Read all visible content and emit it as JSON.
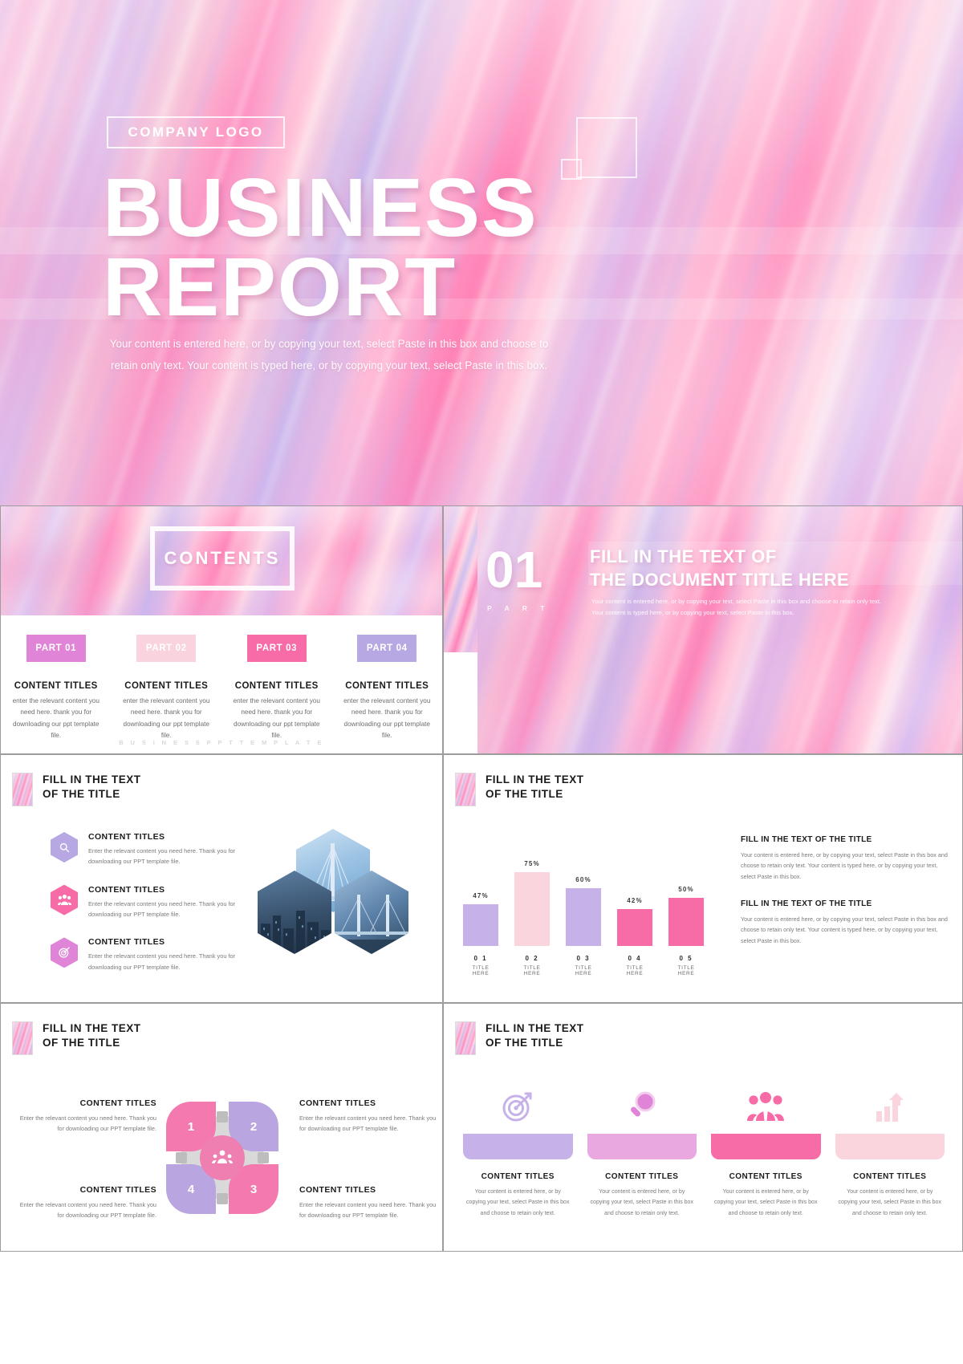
{
  "cover": {
    "logo": "COMPANY LOGO",
    "title_line1": "BUSINESS",
    "title_line2": "REPORT",
    "subtitle": "Your content is entered here, or by copying your text, select Paste in this box and choose to retain only text. Your content is typed here, or by copying your text, select Paste in this box."
  },
  "contents": {
    "heading": "CONTENTS",
    "footer": "B U S I N E S S   P P T   T E M P L A T E",
    "parts": [
      {
        "badge": "PART 01",
        "color": "#e084d8",
        "title": "CONTENT TITLES",
        "body": "enter the relevant content you need here. thank you for downloading our ppt template file."
      },
      {
        "badge": "PART 02",
        "color": "#f9d3dd",
        "title": "CONTENT TITLES",
        "body": "enter the relevant content you need here. thank you for downloading our ppt template file."
      },
      {
        "badge": "PART 03",
        "color": "#f76ba6",
        "title": "CONTENT TITLES",
        "body": "enter the relevant content you need here. thank you for downloading our ppt template file."
      },
      {
        "badge": "PART 04",
        "color": "#b7a8e3",
        "title": "CONTENT TITLES",
        "body": "enter the relevant content you need here. thank you for downloading our ppt template file."
      }
    ]
  },
  "section": {
    "number": "01",
    "part_word": "P A R T",
    "title_line1": "FILL IN THE TEXT OF",
    "title_line2": "THE DOCUMENT TITLE HERE",
    "body_line1": "Your content is entered here, or by copying your text, select Paste in this box and choose to retain only text.",
    "body_line2": "Your content is typed here, or by copying your text, select Paste in this box."
  },
  "slide_hex": {
    "title_line1": "FILL IN THE TEXT",
    "title_line2": "OF THE TITLE",
    "items": [
      {
        "icon": "magnifier-icon",
        "color": "#b7a8e3",
        "title": "CONTENT TITLES",
        "body": "Enter the relevant content you need here. Thank you for downloading our PPT template file."
      },
      {
        "icon": "people-icon",
        "color": "#f76ba6",
        "title": "CONTENT TITLES",
        "body": "Enter the relevant content you need here. Thank you for downloading our PPT template file."
      },
      {
        "icon": "target-icon",
        "color": "#e084d8",
        "title": "CONTENT TITLES",
        "body": "Enter the relevant content you need here. Thank you for downloading our PPT template file."
      }
    ]
  },
  "slide_chart": {
    "title_line1": "FILL IN THE TEXT",
    "title_line2": "OF THE TITLE",
    "blocks": [
      {
        "title": "FILL IN THE TEXT OF THE TITLE",
        "body": "Your content is entered here, or by copying your text, select Paste in this box and choose to retain only text. Your content is typed here, or by copying your text, select Paste in this box."
      },
      {
        "title": "FILL IN THE TEXT OF THE TITLE",
        "body": "Your content is entered here, or by copying your text, select Paste in this box and choose to retain only text. Your content is typed here, or by copying your text, select Paste in this box."
      }
    ]
  },
  "chart_data": {
    "type": "bar",
    "title": "FILL IN THE TEXT OF THE TITLE",
    "categories": [
      "0 1",
      "0 2",
      "0 3",
      "0 4",
      "0 5"
    ],
    "category_sublabels": [
      "TITLE HERE",
      "TITLE HERE",
      "TITLE HERE",
      "TITLE HERE",
      "TITLE HERE"
    ],
    "values": [
      47,
      75,
      60,
      42,
      50
    ],
    "value_labels": [
      "47%",
      "75%",
      "60%",
      "42%",
      "50%"
    ],
    "colors": [
      "#c6b2e8",
      "#fbd5de",
      "#c6b2e8",
      "#f76ba6",
      "#f76ba6"
    ],
    "ylim": [
      0,
      100
    ],
    "xlabel": "",
    "ylabel": "",
    "grid": false,
    "legend": false
  },
  "slide_wheel": {
    "title_line1": "FILL IN THE TEXT",
    "title_line2": "OF THE TITLE",
    "center_icon": "gear-people-icon",
    "petals": [
      {
        "num": "1",
        "color": "#f479ae"
      },
      {
        "num": "2",
        "color": "#b9a5e0"
      },
      {
        "num": "3",
        "color": "#f479ae"
      },
      {
        "num": "4",
        "color": "#b9a5e0"
      }
    ],
    "labels": [
      {
        "title": "CONTENT TITLES",
        "body": "Enter the relevant content you need here. Thank you for downloading our PPT template file."
      },
      {
        "title": "CONTENT TITLES",
        "body": "Enter the relevant content you need here. Thank you for downloading our PPT template file."
      },
      {
        "title": "CONTENT TITLES",
        "body": "Enter the relevant content you need here. Thank you for downloading our PPT template file."
      },
      {
        "title": "CONTENT TITLES",
        "body": "Enter the relevant content you need here. Thank you for downloading our PPT template file."
      }
    ]
  },
  "slide_cards": {
    "title_line1": "FILL IN THE TEXT",
    "title_line2": "OF THE TITLE",
    "cards": [
      {
        "icon": "target-icon",
        "color": "#c6b2e8",
        "tray": "#c6b2e8",
        "title": "CONTENT TITLES",
        "body": "Your content is entered here, or by copying your text, select Paste in this box and choose to retain only text."
      },
      {
        "icon": "magnifier-icon",
        "color": "#e084d8",
        "tray": "#e9a8e0",
        "title": "CONTENT TITLES",
        "body": "Your content is entered here, or by copying your text, select Paste in this box and choose to retain only text."
      },
      {
        "icon": "people-icon",
        "color": "#f76ba6",
        "tray": "#f76ba6",
        "title": "CONTENT TITLES",
        "body": "Your content is entered here, or by copying your text, select Paste in this box and choose to retain only text."
      },
      {
        "icon": "growth-chart-icon",
        "color": "#fbd5de",
        "tray": "#fbd5de",
        "title": "CONTENT TITLES",
        "body": "Your content is entered here, or by copying your text, select Paste in this box and choose to retain only text."
      }
    ]
  }
}
